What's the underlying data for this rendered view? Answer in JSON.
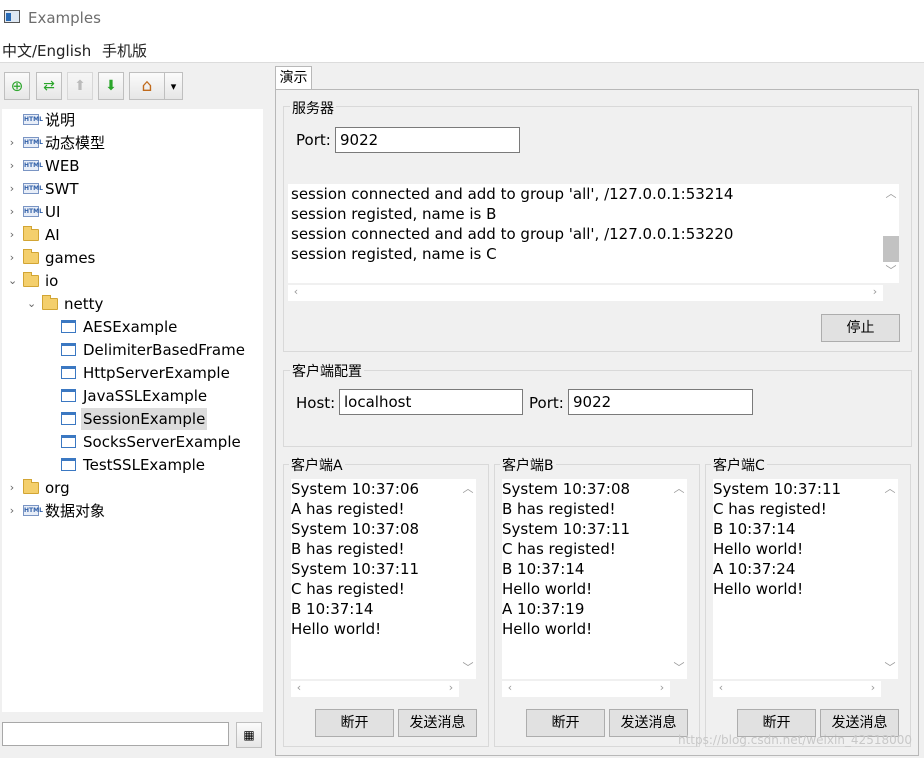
{
  "window": {
    "title": "Examples"
  },
  "menu": [
    "中文/English",
    "手机版"
  ],
  "toolbar": {
    "buttons": [
      {
        "name": "add-icon",
        "glyph": "⊕"
      },
      {
        "name": "refresh-icon",
        "glyph": "⇄"
      },
      {
        "name": "up-icon",
        "glyph": "⬆"
      },
      {
        "name": "down-icon",
        "glyph": "⬇"
      },
      {
        "name": "home-icon",
        "glyph": "⌂"
      },
      {
        "name": "chevron-down-icon",
        "glyph": "▾"
      }
    ]
  },
  "tree": [
    {
      "label": "说明",
      "icon": "html",
      "depth": 0,
      "arrow": ""
    },
    {
      "label": "动态模型",
      "icon": "html",
      "depth": 0,
      "arrow": "›"
    },
    {
      "label": "WEB",
      "icon": "html",
      "depth": 0,
      "arrow": "›"
    },
    {
      "label": "SWT",
      "icon": "html",
      "depth": 0,
      "arrow": "›"
    },
    {
      "label": "UI",
      "icon": "html",
      "depth": 0,
      "arrow": "›"
    },
    {
      "label": "AI",
      "icon": "folder",
      "depth": 0,
      "arrow": "›"
    },
    {
      "label": "games",
      "icon": "folder",
      "depth": 0,
      "arrow": "›"
    },
    {
      "label": "io",
      "icon": "folder",
      "depth": 0,
      "arrow": "⌄"
    },
    {
      "label": "netty",
      "icon": "folder",
      "depth": 1,
      "arrow": "⌄"
    },
    {
      "label": "AESExample",
      "icon": "win",
      "depth": 2,
      "arrow": ""
    },
    {
      "label": "DelimiterBasedFrame",
      "icon": "win",
      "depth": 2,
      "arrow": ""
    },
    {
      "label": "HttpServerExample",
      "icon": "win",
      "depth": 2,
      "arrow": ""
    },
    {
      "label": "JavaSSLExample",
      "icon": "win",
      "depth": 2,
      "arrow": ""
    },
    {
      "label": "SessionExample",
      "icon": "win",
      "depth": 2,
      "arrow": "",
      "selected": true
    },
    {
      "label": "SocksServerExample",
      "icon": "win",
      "depth": 2,
      "arrow": ""
    },
    {
      "label": "TestSSLExample",
      "icon": "win",
      "depth": 2,
      "arrow": ""
    },
    {
      "label": "org",
      "icon": "folder",
      "depth": 0,
      "arrow": "›"
    },
    {
      "label": "数据对象",
      "icon": "html",
      "depth": 0,
      "arrow": "›"
    }
  ],
  "tab": {
    "label": "演示"
  },
  "server": {
    "group_title": "服务器",
    "port_label": "Port:",
    "port_value": "9022",
    "log": [
      "session connected and add to group 'all', /127.0.0.1:53214",
      "session registed, name is B",
      "session connected and add to group 'all', /127.0.0.1:53220",
      "session registed, name is C"
    ],
    "stop_button": "停止"
  },
  "client_config": {
    "group_title": "客户端配置",
    "host_label": "Host:",
    "host_value": "localhost",
    "port_label": "Port:",
    "port_value": "9022"
  },
  "clients": [
    {
      "title": "客户端A",
      "messages": [
        "System 10:37:06",
        "A has registed!",
        "System 10:37:08",
        "B has registed!",
        "System 10:37:11",
        "C has registed!",
        "B 10:37:14",
        "Hello world!"
      ],
      "disconnect": "断开",
      "send": "发送消息"
    },
    {
      "title": "客户端B",
      "messages": [
        "System 10:37:08",
        "B has registed!",
        "System 10:37:11",
        "C has registed!",
        "B 10:37:14",
        "Hello world!",
        "A 10:37:19",
        "Hello world!"
      ],
      "disconnect": "断开",
      "send": "发送消息"
    },
    {
      "title": "客户端C",
      "messages": [
        "System 10:37:11",
        "C has registed!",
        "B 10:37:14",
        "Hello world!",
        "A 10:37:24",
        "Hello world!"
      ],
      "disconnect": "断开",
      "send": "发送消息"
    }
  ],
  "search": {
    "button_glyph": "▦"
  },
  "watermark": "https://blog.csdn.net/weixin_42518000"
}
